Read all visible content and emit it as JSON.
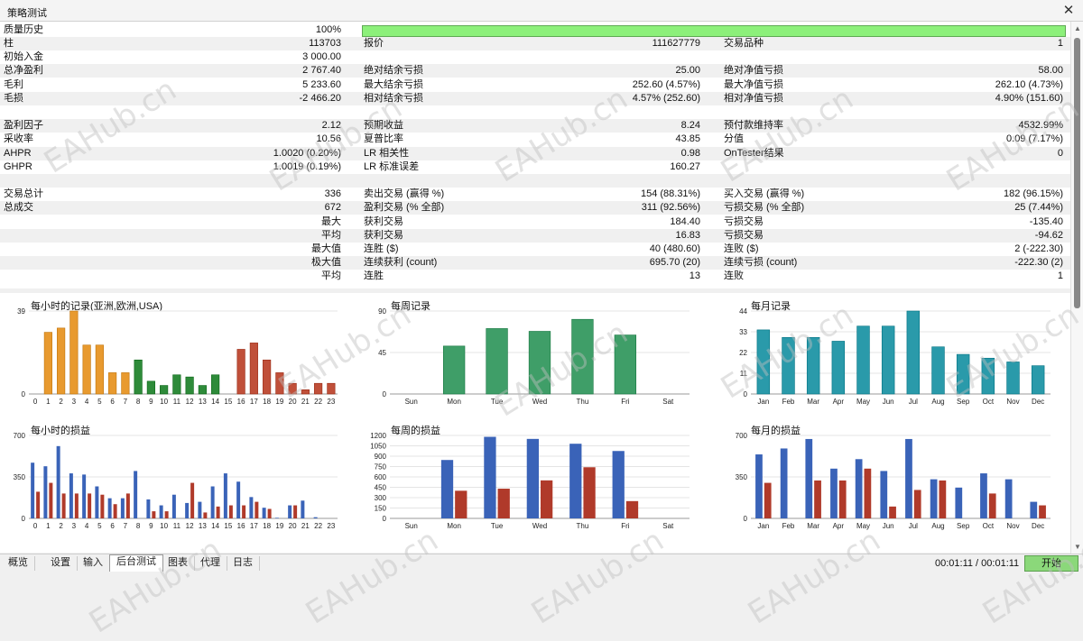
{
  "window": {
    "title": "策略测试",
    "close_icon": "close-icon"
  },
  "quality": {
    "label": "质量历史",
    "value": "100%",
    "fill_fraction": 1.0
  },
  "rows": [
    {
      "alt": true,
      "c": [
        {
          "l": "柱",
          "v": "113703"
        },
        {
          "l": "报价",
          "v": "111627779"
        },
        {
          "l": "交易品种",
          "v": "1"
        }
      ]
    },
    {
      "alt": false,
      "c": [
        {
          "l": "初始入金",
          "v": "3 000.00"
        },
        {
          "l": "",
          "v": ""
        },
        {
          "l": "",
          "v": ""
        }
      ]
    },
    {
      "alt": true,
      "c": [
        {
          "l": "总净盈利",
          "v": "2 767.40"
        },
        {
          "l": "绝对结余亏损",
          "v": "25.00"
        },
        {
          "l": "绝对净值亏损",
          "v": "58.00"
        }
      ]
    },
    {
      "alt": false,
      "c": [
        {
          "l": "毛利",
          "v": "5 233.60"
        },
        {
          "l": "最大结余亏损",
          "v": "252.60 (4.57%)"
        },
        {
          "l": "最大净值亏损",
          "v": "262.10 (4.73%)"
        }
      ]
    },
    {
      "alt": true,
      "c": [
        {
          "l": "毛损",
          "v": "-2 466.20"
        },
        {
          "l": "相对结余亏损",
          "v": "4.57% (252.60)"
        },
        {
          "l": "相对净值亏损",
          "v": "4.90% (151.60)"
        }
      ]
    },
    {
      "alt": false,
      "c": [
        {
          "l": "",
          "v": ""
        },
        {
          "l": "",
          "v": ""
        },
        {
          "l": "",
          "v": ""
        }
      ]
    },
    {
      "alt": true,
      "c": [
        {
          "l": "盈利因子",
          "v": "2.12"
        },
        {
          "l": "预期收益",
          "v": "8.24"
        },
        {
          "l": "预付款维持率",
          "v": "4532.99%"
        }
      ]
    },
    {
      "alt": false,
      "c": [
        {
          "l": "采收率",
          "v": "10.56"
        },
        {
          "l": "夏普比率",
          "v": "43.85"
        },
        {
          "l": "分值",
          "v": "0.09 (7.17%)"
        }
      ]
    },
    {
      "alt": true,
      "c": [
        {
          "l": "AHPR",
          "v": "1.0020 (0.20%)"
        },
        {
          "l": "LR 相关性",
          "v": "0.98"
        },
        {
          "l": "OnTester结果",
          "v": "0"
        }
      ]
    },
    {
      "alt": false,
      "c": [
        {
          "l": "GHPR",
          "v": "1.0019 (0.19%)"
        },
        {
          "l": "LR 标准误差",
          "v": "160.27"
        },
        {
          "l": "",
          "v": ""
        }
      ]
    },
    {
      "alt": true,
      "c": [
        {
          "l": "",
          "v": ""
        },
        {
          "l": "",
          "v": ""
        },
        {
          "l": "",
          "v": ""
        }
      ]
    },
    {
      "alt": false,
      "c": [
        {
          "l": "交易总计",
          "v": "336"
        },
        {
          "l": "卖出交易 (赢得 %)",
          "v": "154 (88.31%)"
        },
        {
          "l": "买入交易 (赢得 %)",
          "v": "182 (96.15%)"
        }
      ]
    },
    {
      "alt": true,
      "c": [
        {
          "l": "总成交",
          "v": "672"
        },
        {
          "l": "盈利交易 (% 全部)",
          "v": "311 (92.56%)"
        },
        {
          "l": "亏损交易 (% 全部)",
          "v": "25 (7.44%)"
        }
      ]
    },
    {
      "alt": false,
      "c": [
        {
          "l": "",
          "v": "",
          "r": "最大"
        },
        {
          "l": "获利交易",
          "v": "184.40"
        },
        {
          "l": "亏损交易",
          "v": "-135.40"
        }
      ]
    },
    {
      "alt": true,
      "c": [
        {
          "l": "",
          "v": "",
          "r": "平均"
        },
        {
          "l": "获利交易",
          "v": "16.83"
        },
        {
          "l": "亏损交易",
          "v": "-94.62"
        }
      ]
    },
    {
      "alt": false,
      "c": [
        {
          "l": "",
          "v": "",
          "r": "最大值"
        },
        {
          "l": "连胜 ($)",
          "v": "40 (480.60)"
        },
        {
          "l": "连败 ($)",
          "v": "2 (-222.30)"
        }
      ]
    },
    {
      "alt": true,
      "c": [
        {
          "l": "",
          "v": "",
          "r": "极大值"
        },
        {
          "l": "连续获利 (count)",
          "v": "695.70 (20)"
        },
        {
          "l": "连续亏损 (count)",
          "v": "-222.30 (2)"
        }
      ]
    },
    {
      "alt": false,
      "c": [
        {
          "l": "",
          "v": "",
          "r": "平均"
        },
        {
          "l": "连胜",
          "v": "13"
        },
        {
          "l": "连败",
          "v": "1"
        }
      ]
    }
  ],
  "chart_data": [
    {
      "id": "hourly-count",
      "type": "bar",
      "title": "每小时的记录(亚洲,欧洲,USA)",
      "categories": [
        "0",
        "1",
        "2",
        "3",
        "4",
        "5",
        "6",
        "7",
        "8",
        "9",
        "10",
        "11",
        "12",
        "13",
        "14",
        "15",
        "16",
        "17",
        "18",
        "19",
        "20",
        "21",
        "22",
        "23"
      ],
      "values": [
        0,
        29,
        31,
        39,
        23,
        23,
        10,
        10,
        16,
        6,
        4,
        9,
        8,
        4,
        9,
        0,
        21,
        24,
        16,
        10,
        5,
        2,
        5,
        5,
        1
      ],
      "ylim": [
        0,
        39
      ],
      "yticks": [
        "0",
        "39"
      ],
      "colors": [
        "#e89a2f",
        "#e89a2f",
        "#e89a2f",
        "#e89a2f",
        "#e89a2f",
        "#e89a2f",
        "#e89a2f",
        "#e89a2f",
        "#2e8b3a",
        "#2e8b3a",
        "#2e8b3a",
        "#2e8b3a",
        "#2e8b3a",
        "#2e8b3a",
        "#2e8b3a",
        "#c0503a",
        "#c0503a",
        "#c0503a",
        "#c0503a",
        "#c0503a",
        "#c0503a",
        "#c0503a",
        "#c0503a",
        "#c0503a"
      ]
    },
    {
      "id": "weekly-count",
      "type": "bar",
      "title": "每周记录",
      "categories": [
        "Sun",
        "Mon",
        "Tue",
        "Wed",
        "Thu",
        "Fri",
        "Sat"
      ],
      "values": [
        0,
        52,
        71,
        68,
        81,
        64,
        0
      ],
      "ylim": [
        0,
        90
      ],
      "yticks": [
        "0",
        "45",
        "90"
      ],
      "colors": [
        "#3f9e68"
      ]
    },
    {
      "id": "monthly-count",
      "type": "bar",
      "title": "每月记录",
      "categories": [
        "Jan",
        "Feb",
        "Mar",
        "Apr",
        "May",
        "Jun",
        "Jul",
        "Aug",
        "Sep",
        "Oct",
        "Nov",
        "Dec"
      ],
      "values": [
        34,
        30,
        30,
        28,
        36,
        36,
        44,
        25,
        21,
        19,
        17,
        15
      ],
      "ylim": [
        0,
        44
      ],
      "yticks": [
        "0",
        "11",
        "22",
        "33",
        "44"
      ],
      "colors": [
        "#2a9aaa"
      ]
    },
    {
      "id": "hourly-pl",
      "type": "bar",
      "title": "每小时的损益",
      "categories": [
        "0",
        "1",
        "2",
        "3",
        "4",
        "5",
        "6",
        "7",
        "8",
        "9",
        "10",
        "11",
        "12",
        "13",
        "14",
        "15",
        "16",
        "17",
        "18",
        "19",
        "20",
        "21",
        "22",
        "23"
      ],
      "series": [
        {
          "values": [
            470,
            440,
            610,
            380,
            370,
            270,
            170,
            170,
            400,
            160,
            110,
            200,
            130,
            140,
            270,
            380,
            310,
            180,
            90,
            5,
            110,
            150,
            10,
            0
          ]
        },
        {
          "values": [
            225,
            300,
            210,
            210,
            210,
            200,
            120,
            210,
            0,
            60,
            60,
            0,
            300,
            50,
            100,
            110,
            110,
            140,
            80,
            0,
            110,
            0,
            0,
            0
          ]
        }
      ],
      "ylim": [
        0,
        700
      ],
      "yticks": [
        "0",
        "350",
        "700"
      ],
      "colors": [
        "#3a63b8",
        "#b03a2a"
      ]
    },
    {
      "id": "weekly-pl",
      "type": "bar",
      "title": "每周的损益",
      "categories": [
        "Sun",
        "Mon",
        "Tue",
        "Wed",
        "Thu",
        "Fri",
        "Sat"
      ],
      "series": [
        {
          "values": [
            0,
            845,
            1180,
            1150,
            1080,
            975,
            0
          ]
        },
        {
          "values": [
            0,
            400,
            430,
            550,
            740,
            250,
            0
          ]
        }
      ],
      "ylim": [
        0,
        1200
      ],
      "yticks": [
        "0",
        "150",
        "300",
        "450",
        "600",
        "750",
        "900",
        "1050",
        "1200"
      ],
      "colors": [
        "#3a63b8",
        "#b03a2a"
      ]
    },
    {
      "id": "monthly-pl",
      "type": "bar",
      "title": "每月的损益",
      "categories": [
        "Jan",
        "Feb",
        "Mar",
        "Apr",
        "May",
        "Jun",
        "Jul",
        "Aug",
        "Sep",
        "Oct",
        "Nov",
        "Dec"
      ],
      "series": [
        {
          "values": [
            540,
            590,
            670,
            420,
            500,
            400,
            670,
            330,
            260,
            380,
            330,
            140
          ]
        },
        {
          "values": [
            300,
            0,
            320,
            320,
            420,
            100,
            240,
            320,
            0,
            210,
            0,
            110
          ]
        }
      ],
      "ylim": [
        0,
        700
      ],
      "yticks": [
        "0",
        "350",
        "700"
      ],
      "colors": [
        "#3a63b8",
        "#b03a2a"
      ]
    }
  ],
  "watermark": "EAHub.cn",
  "tabs": [
    {
      "label": "概览",
      "active": false
    },
    {
      "label": "设置",
      "active": false
    },
    {
      "label": "输入",
      "active": false
    },
    {
      "label": "后台测试",
      "active": true
    },
    {
      "label": "图表",
      "active": false
    },
    {
      "label": "代理",
      "active": false
    },
    {
      "label": "日志",
      "active": false
    }
  ],
  "timer": "00:01:11 / 00:01:11",
  "start_label": "开始"
}
